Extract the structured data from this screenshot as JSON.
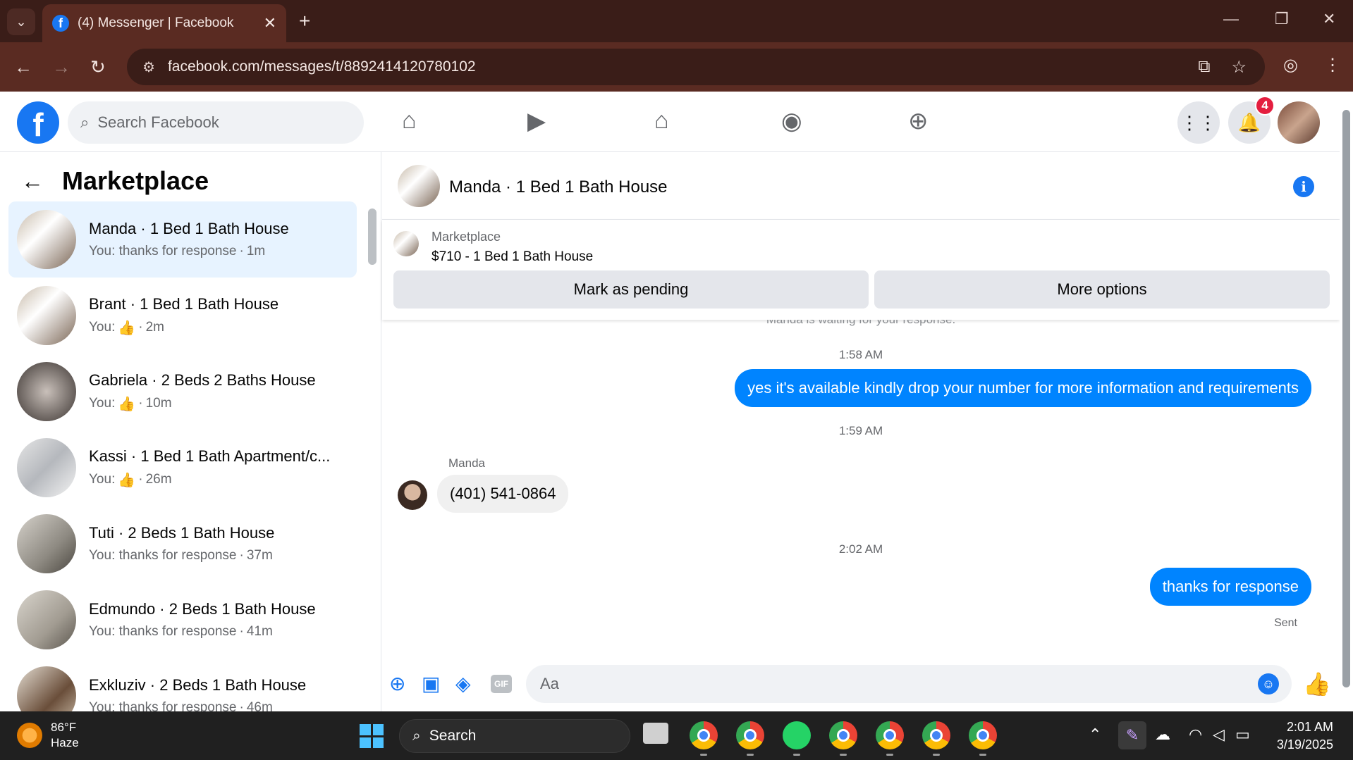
{
  "browser": {
    "tab_title": "(4) Messenger | Facebook",
    "url": "facebook.com/messages/t/8892414120780102"
  },
  "fb": {
    "search_placeholder": "Search Facebook",
    "notification_count": "4"
  },
  "sidebar": {
    "title": "Marketplace",
    "conversations": [
      {
        "title": "Manda · 1 Bed 1 Bath House",
        "prefix": "You: thanks for response",
        "time": "1m"
      },
      {
        "title": "Brant · 1 Bed 1 Bath House",
        "prefix": "You:",
        "time": "2m",
        "like": true
      },
      {
        "title": "Gabriela · 2 Beds 2 Baths House",
        "prefix": "You:",
        "time": "10m",
        "like": true
      },
      {
        "title": "Kassi · 1 Bed 1 Bath Apartment/c...",
        "prefix": "You:",
        "time": "26m",
        "like": true
      },
      {
        "title": "Tuti · 2 Beds 1 Bath House",
        "prefix": "You: thanks for response",
        "time": "37m"
      },
      {
        "title": "Edmundo · 2 Beds 1 Bath House",
        "prefix": "You: thanks for response",
        "time": "41m"
      },
      {
        "title": "Exkluziv · 2 Beds 1 Bath House",
        "prefix": "You: thanks for response",
        "time": "46m"
      }
    ]
  },
  "chat": {
    "header_title": "Manda · 1 Bed 1 Bath House",
    "listing_label": "Marketplace",
    "listing_price": "$710 - 1 Bed 1 Bath House",
    "mark_pending": "Mark as pending",
    "more_options": "More options",
    "faded_notice": "Manda is waiting for your response.",
    "messages": [
      {
        "type": "time",
        "text": "1:58 AM"
      },
      {
        "type": "out",
        "text": "yes it's available kindly drop your number for more information and requirements"
      },
      {
        "type": "time",
        "text": "1:59 AM"
      },
      {
        "type": "in",
        "sender": "Manda",
        "text": "(401) 541-0864"
      },
      {
        "type": "time",
        "text": "2:02 AM"
      },
      {
        "type": "out",
        "text": "thanks for response"
      }
    ],
    "sent_label": "Sent",
    "composer_placeholder": "Aa"
  },
  "taskbar": {
    "temp": "86°F",
    "condition": "Haze",
    "search": "Search",
    "time": "2:01 AM",
    "date": "3/19/2025"
  },
  "colors": {
    "accent": "#1877f2",
    "bubble": "#0084ff",
    "chrome_dark": "#3a1d18"
  }
}
